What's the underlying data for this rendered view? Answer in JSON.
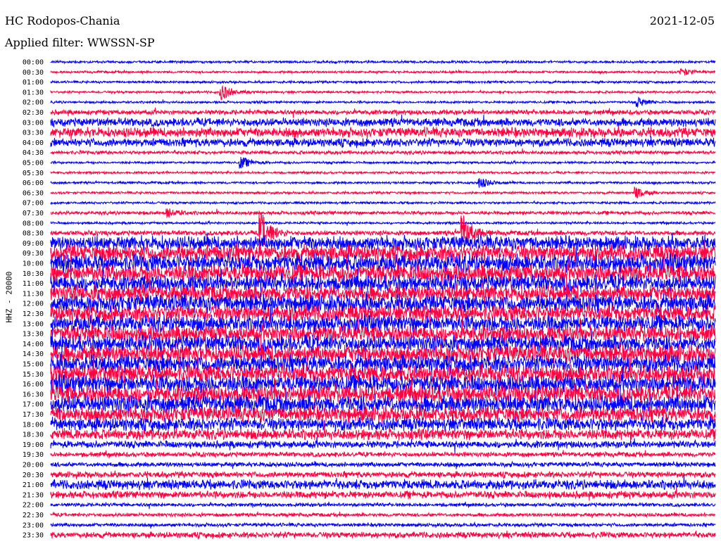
{
  "header": {
    "station": "HC Rodopos-Chania",
    "filter": "Applied filter: WWSSN-SP",
    "date": "2021-12-05"
  },
  "chart_data": {
    "type": "line",
    "title": "HC Rodopos-Chania",
    "ylabel": "HHZ - 20000",
    "row_labels": [
      "00:00",
      "00:30",
      "01:00",
      "01:30",
      "02:00",
      "02:30",
      "03:00",
      "03:30",
      "04:00",
      "04:30",
      "05:00",
      "05:30",
      "06:00",
      "06:30",
      "07:00",
      "07:30",
      "08:00",
      "08:30",
      "09:00",
      "09:30",
      "10:00",
      "10:30",
      "11:00",
      "11:30",
      "12:00",
      "12:30",
      "13:00",
      "13:30",
      "14:00",
      "14:30",
      "15:00",
      "15:30",
      "16:00",
      "16:30",
      "17:00",
      "17:30",
      "18:00",
      "18:30",
      "19:00",
      "19:30",
      "20:00",
      "20:30",
      "21:00",
      "21:30",
      "22:00",
      "22:30",
      "23:00",
      "23:30"
    ],
    "row_minutes": 30,
    "colors": [
      "#0000ff",
      "#ff0040"
    ],
    "noise_level": [
      2,
      2,
      2,
      2,
      2,
      4,
      7,
      8,
      7,
      3,
      2,
      2,
      2,
      2,
      2,
      3,
      2,
      4,
      12,
      14,
      15,
      15,
      14,
      14,
      15,
      14,
      14,
      14,
      14,
      15,
      15,
      15,
      15,
      15,
      15,
      13,
      11,
      9,
      6,
      4,
      4,
      5,
      8,
      6,
      3,
      3,
      3,
      5
    ],
    "events": [
      {
        "row": 1,
        "at_minute": 28.5,
        "amp": 5
      },
      {
        "row": 3,
        "at_minute": 7.7,
        "amp": 12
      },
      {
        "row": 4,
        "at_minute": 26.5,
        "amp": 6
      },
      {
        "row": 10,
        "at_minute": 8.6,
        "amp": 8
      },
      {
        "row": 12,
        "at_minute": 19.4,
        "amp": 7
      },
      {
        "row": 13,
        "at_minute": 26.4,
        "amp": 8
      },
      {
        "row": 15,
        "at_minute": 5.3,
        "amp": 6
      },
      {
        "row": 17,
        "at_minute": 9.5,
        "amp": 30
      },
      {
        "row": 17,
        "at_minute": 18.6,
        "amp": 28
      }
    ]
  }
}
